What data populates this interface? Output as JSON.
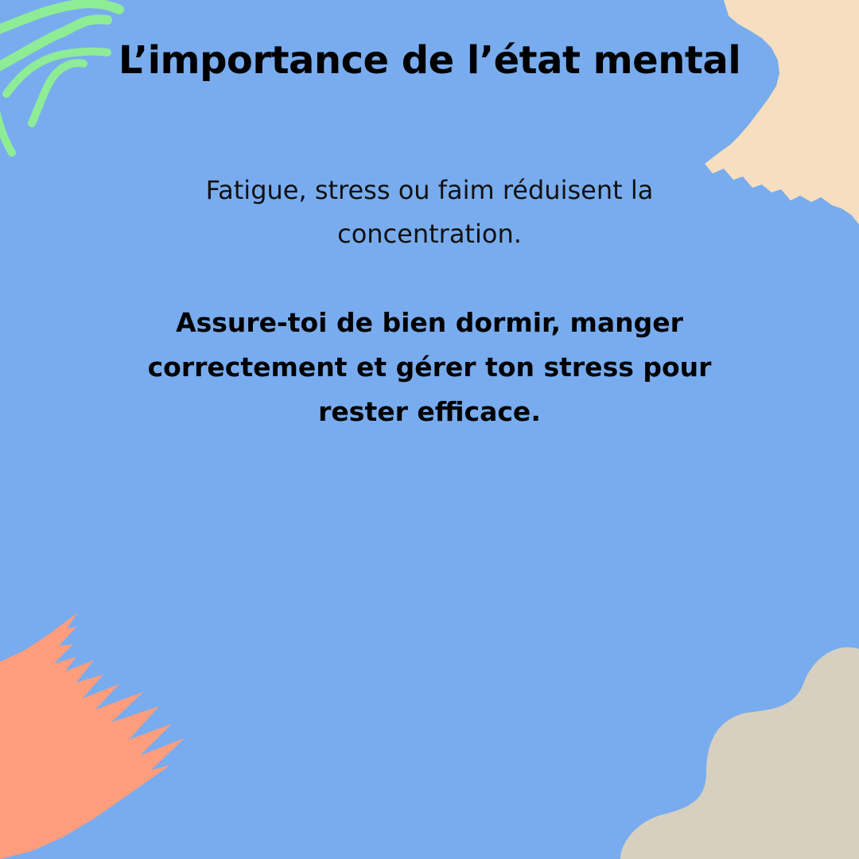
{
  "slide": {
    "title": "L’importance de l’état mental",
    "intro": "Fatigue, stress ou faim réduisent la concentration.",
    "advice": "Assure-toi de bien dormir, manger correctement et gérer ton stress pour rester efficace."
  },
  "colors": {
    "background": "#78ACEE",
    "text": "#000000",
    "green_lines": "#8EEC96",
    "cream_brush": "#F5DFC0",
    "salmon_brush": "#FF9D7D",
    "beige_blob": "#D7D0C0"
  },
  "decorations": {
    "top_left": "green-wavy-lines",
    "top_right": "cream-brush-stroke",
    "bottom_left": "salmon-brush-stroke",
    "bottom_right": "beige-blob"
  }
}
